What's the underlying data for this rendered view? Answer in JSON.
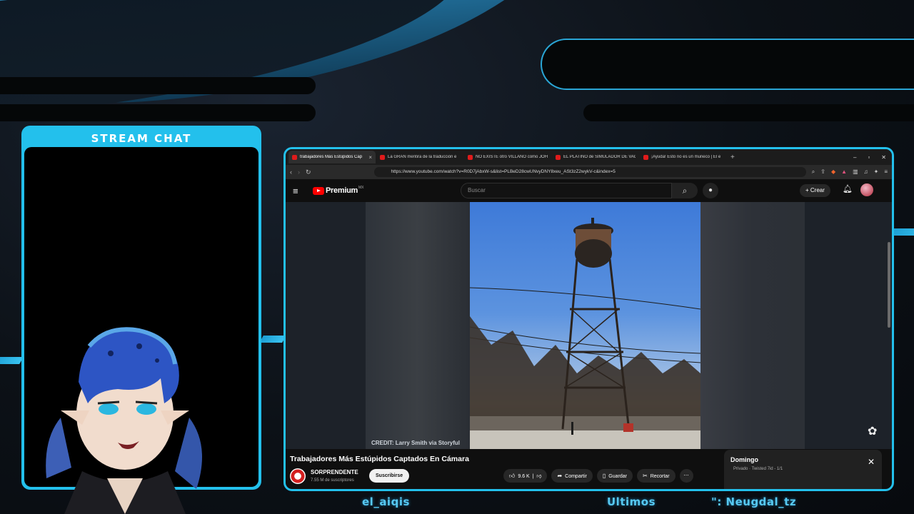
{
  "overlay": {
    "chat_title": "STREAM CHAT",
    "ticker": [
      "el_aiqis",
      "Ultimos",
      "\": Neugdal_tz"
    ],
    "accent": "#23c0ec"
  },
  "browser": {
    "tabs": [
      {
        "title": "trabajadores Más Estúpidos Cap",
        "active": true
      },
      {
        "title": "La GRAN mentira de la traducción e",
        "active": false
      },
      {
        "title": "NO EXISTE otro VILLANO como JOH",
        "active": false
      },
      {
        "title": "EL PLATINO de SIMULADOR DE VAC",
        "active": false
      },
      {
        "title": "¡Ayuda! Esto no es un muñeco | El e",
        "active": false
      }
    ],
    "url": "https://www.youtube.com/watch?v=R0D7jAbxW-s&list=PLBeD28cwUNvyDNY8xeu_ASt3zZ2wykV-c&index=5"
  },
  "youtube": {
    "logo_text": "Premium",
    "logo_region": "MX",
    "search_placeholder": "Buscar",
    "create_label": "+ Crear",
    "video_title": "Trabajadores Más Estúpidos Captados En Cámara",
    "credit": "CREDIT: Larry Smith via Storyful",
    "channel_name": "SORPRENDENTE",
    "channel_subs": "7.55 M de suscriptores",
    "subscribe_label": "Suscribirse",
    "likes": "9.6 K",
    "share_label": "Compartir",
    "save_label": "Guardar",
    "clip_label": "Recortar",
    "playlist_title": "Domingo",
    "playlist_sub": "Privado · Twisted 7id - 1/1"
  }
}
